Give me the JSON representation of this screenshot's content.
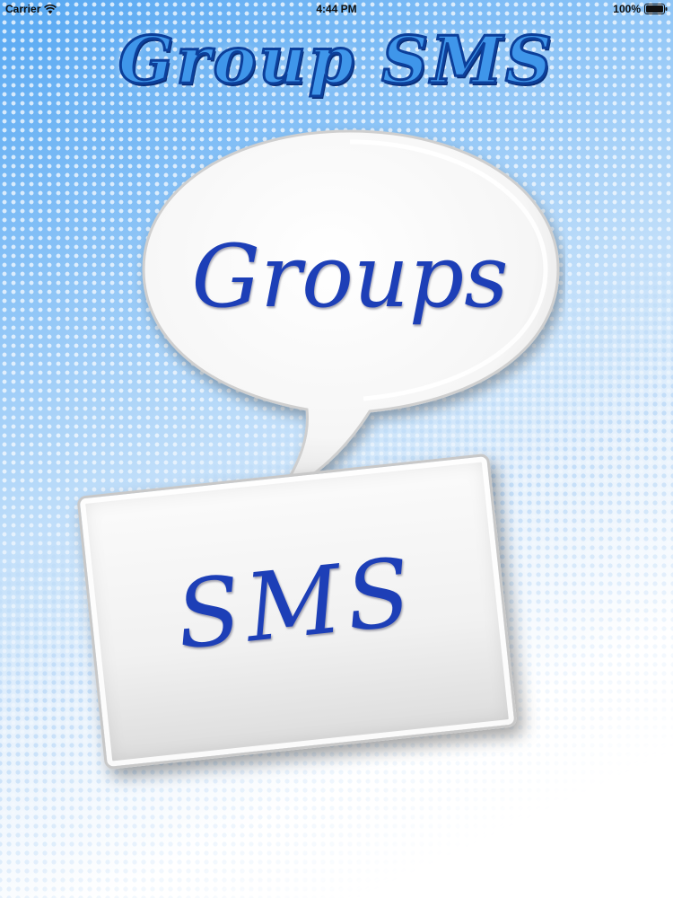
{
  "status_bar": {
    "carrier": "Carrier",
    "time": "4:44 PM",
    "battery": "100%",
    "wifi_icon": "wifi-icon",
    "battery_icon": "battery-icon"
  },
  "app": {
    "title": "Group SMS"
  },
  "buttons": {
    "groups_label": "Groups",
    "sms_label": "SMS"
  },
  "colors": {
    "title_fill": "#3f96ea",
    "title_stroke": "#0c3f9a",
    "label_text": "#1d3fb7",
    "background_top": "#57a8f2",
    "background_bottom": "#ffffff"
  }
}
